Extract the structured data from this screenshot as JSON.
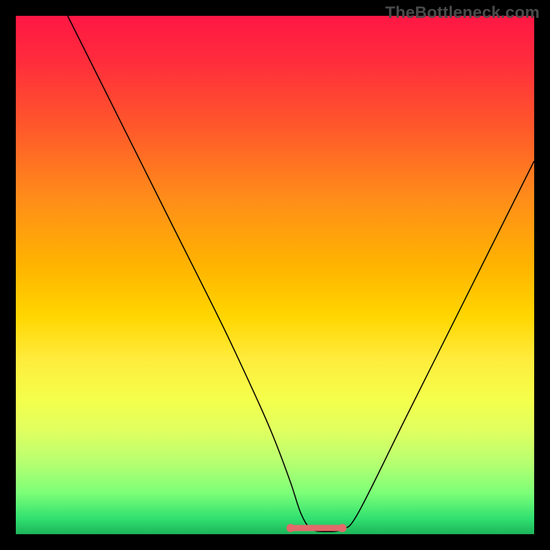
{
  "brand": "TheBottleneck.com",
  "chart_data": {
    "type": "line",
    "title": "",
    "xlabel": "",
    "ylabel": "",
    "xlim": [
      0,
      100
    ],
    "ylim": [
      0,
      100
    ],
    "series": [
      {
        "name": "curve",
        "x": [
          10,
          20,
          30,
          40,
          47,
          50,
          53,
          55,
          57,
          60,
          63,
          66,
          75,
          85,
          100
        ],
        "values": [
          100,
          80,
          60,
          40,
          25,
          18,
          10,
          4,
          1,
          0.5,
          1,
          4,
          22,
          42,
          72
        ]
      }
    ],
    "optimal_band": {
      "x_start": 53,
      "x_end": 63,
      "y": 1.2
    },
    "background_gradient": {
      "stops": [
        {
          "pos": 0,
          "color": "#ff1744"
        },
        {
          "pos": 22,
          "color": "#ff5a2a"
        },
        {
          "pos": 48,
          "color": "#ffb300"
        },
        {
          "pos": 66,
          "color": "#ffeb3b"
        },
        {
          "pos": 86,
          "color": "#b8ff70"
        },
        {
          "pos": 100,
          "color": "#1db45a"
        }
      ]
    }
  }
}
